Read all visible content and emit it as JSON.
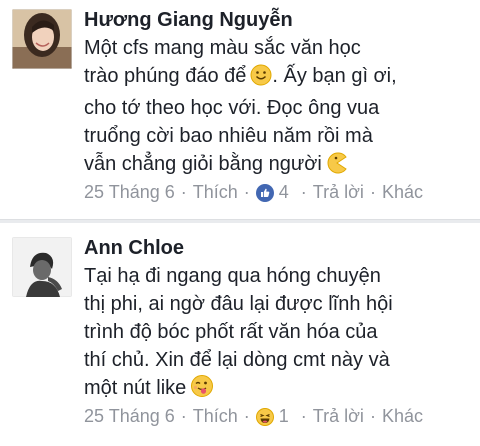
{
  "comments": [
    {
      "author": "Hương Giang Nguyễn",
      "lines": [
        "Một cfs mang màu sắc văn học",
        "trào phúng đáo để",
        "Ấy bạn gì ơi,",
        "cho tớ theo học với. Đọc ông vua",
        "truổng cời bao nhiêu năm rồi mà",
        "vẫn chẳng giỏi bằng người"
      ],
      "date": "25 Tháng 6",
      "like_label": "Thích",
      "reaction_icon": "thumbs-up-icon",
      "reaction_count": "4",
      "reply_label": "Trả lời",
      "more_label": "Khác",
      "emojis": [
        "smile-emoji",
        "pacman-emoji"
      ]
    },
    {
      "author": "Ann Chloe",
      "lines": [
        "Tại hạ đi ngang qua hóng chuyện",
        "thị phi, ai ngờ đâu lại được lĩnh hội",
        "trình độ bóc phốt rất văn hóa của",
        "thí chủ. Xin để lại dòng cmt này và",
        "một nút like"
      ],
      "date": "25 Tháng 6",
      "like_label": "Thích",
      "reaction_icon": "laughing-icon",
      "reaction_count": "1",
      "reply_label": "Trả lời",
      "more_label": "Khác",
      "emojis": [
        "tongue-wink-emoji"
      ]
    }
  ],
  "separator": "·",
  "colors": {
    "text": "#1d2129",
    "meta": "#90949c",
    "like_blue": "#4267b2",
    "emoji_yellow": "#f7c948"
  }
}
